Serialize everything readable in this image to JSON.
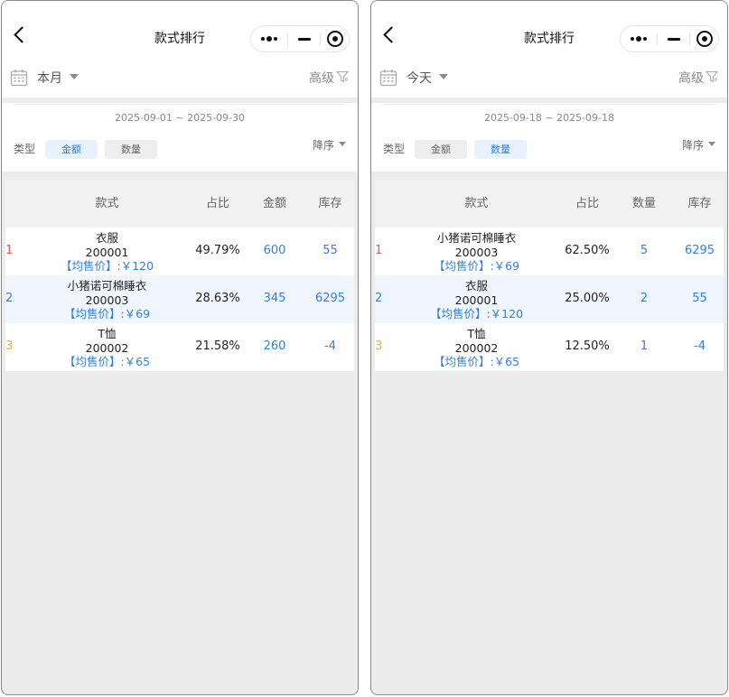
{
  "screens": [
    {
      "title": "款式排行",
      "period": "本月",
      "advanced": "高级",
      "date_range": "2025-09-01 ~ 2025-09-30",
      "type_label": "类型",
      "chips": [
        {
          "label": "金额",
          "active": true
        },
        {
          "label": "数量",
          "active": false
        }
      ],
      "sort": "降序",
      "columns": [
        "款式",
        "占比",
        "金额",
        "库存"
      ],
      "rows": [
        {
          "rank": "1",
          "name": "衣服",
          "code": "200001",
          "price": "【均售价】:￥120",
          "pct": "49.79%",
          "value": "600",
          "stock": "55"
        },
        {
          "rank": "2",
          "name": "小猪诺可棉睡衣",
          "code": "200003",
          "price": "【均售价】:￥69",
          "pct": "28.63%",
          "value": "345",
          "stock": "6295"
        },
        {
          "rank": "3",
          "name": "T恤",
          "code": "200002",
          "price": "【均售价】:￥65",
          "pct": "21.58%",
          "value": "260",
          "stock": "-4"
        }
      ]
    },
    {
      "title": "款式排行",
      "period": "今天",
      "advanced": "高级",
      "date_range": "2025-09-18 ~ 2025-09-18",
      "type_label": "类型",
      "chips": [
        {
          "label": "金额",
          "active": false
        },
        {
          "label": "数量",
          "active": true
        }
      ],
      "sort": "降序",
      "columns": [
        "款式",
        "占比",
        "数量",
        "库存"
      ],
      "rows": [
        {
          "rank": "1",
          "name": "小猪诺可棉睡衣",
          "code": "200003",
          "price": "【均售价】:￥69",
          "pct": "62.50%",
          "value": "5",
          "stock": "6295"
        },
        {
          "rank": "2",
          "name": "衣服",
          "code": "200001",
          "price": "【均售价】:￥120",
          "pct": "25.00%",
          "value": "2",
          "stock": "55"
        },
        {
          "rank": "3",
          "name": "T恤",
          "code": "200002",
          "price": "【均售价】:￥65",
          "pct": "12.50%",
          "value": "1",
          "stock": "-4"
        }
      ]
    }
  ],
  "icons": {
    "back": "chevron-left-icon",
    "more": "more-dots-icon",
    "minimize": "minimize-icon",
    "close": "close-circle-icon",
    "calendar": "calendar-icon",
    "filter": "filter-icon",
    "caret": "caret-down-icon"
  },
  "colors": {
    "accent": "#2f7fe0",
    "rank1": "#e05a5a",
    "rank2": "#3a7fd8",
    "rank3": "#e9b040",
    "background": "#ececec"
  }
}
